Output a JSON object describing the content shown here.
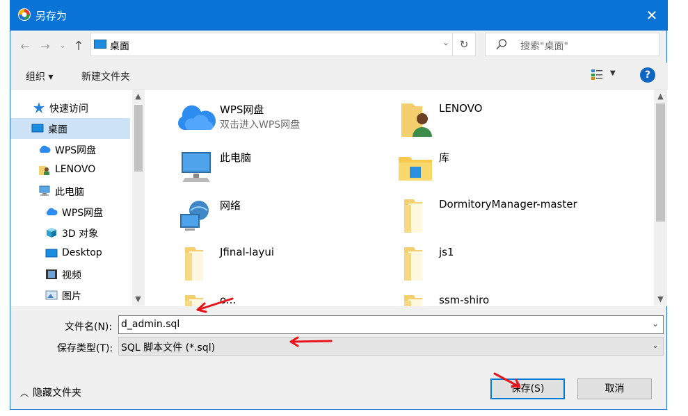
{
  "window": {
    "title": "另存为",
    "close_glyph": "✕"
  },
  "nav": {
    "back": "←",
    "forward": "→",
    "recent": "⌄",
    "up": "↑"
  },
  "address": {
    "location": "桌面",
    "dropdown": "⌄",
    "refresh": "↻"
  },
  "search": {
    "placeholder": "搜索\"桌面\""
  },
  "toolbar": {
    "organize": "组织 ▾",
    "new_folder": "新建文件夹",
    "help": "?"
  },
  "sidebar": {
    "items": [
      {
        "label": "快速访问",
        "icon": "star-icon"
      },
      {
        "label": "桌面",
        "icon": "desktop-icon",
        "selected": true
      },
      {
        "label": "WPS网盘",
        "icon": "cloud-icon"
      },
      {
        "label": "LENOVO",
        "icon": "user-folder-icon"
      },
      {
        "label": "此电脑",
        "icon": "computer-icon"
      },
      {
        "label": "WPS网盘",
        "icon": "cloud-icon"
      },
      {
        "label": "3D 对象",
        "icon": "cube-icon"
      },
      {
        "label": "Desktop",
        "icon": "desktop-icon"
      },
      {
        "label": "视频",
        "icon": "film-icon"
      },
      {
        "label": "图片",
        "icon": "picture-icon"
      }
    ]
  },
  "files": [
    {
      "name": "WPS网盘",
      "sub": "双击进入WPS网盘",
      "icon": "cloud-icon"
    },
    {
      "name": "LENOVO",
      "sub": "",
      "icon": "user-folder-icon"
    },
    {
      "name": "此电脑",
      "sub": "",
      "icon": "computer-icon"
    },
    {
      "name": "库",
      "sub": "",
      "icon": "library-icon"
    },
    {
      "name": "网络",
      "sub": "",
      "icon": "network-icon"
    },
    {
      "name": "DormitoryManager-master",
      "sub": "",
      "icon": "folder-icon"
    },
    {
      "name": "Jfinal-layui",
      "sub": "",
      "icon": "folder-icon"
    },
    {
      "name": "js1",
      "sub": "",
      "icon": "folder-icon"
    },
    {
      "name": "o...",
      "sub": "",
      "icon": "folder-icon"
    },
    {
      "name": "ssm-shiro",
      "sub": "",
      "icon": "folder-icon"
    }
  ],
  "form": {
    "filename_label": "文件名(N):",
    "filename_value": "d_admin.sql",
    "filetype_label": "保存类型(T):",
    "filetype_value": "SQL 脚本文件 (*.sql)"
  },
  "footer": {
    "hide_folders": "隐藏文件夹",
    "save": "保存(S)",
    "cancel": "取消"
  },
  "colors": {
    "titlebar": "#0a74d6",
    "selection": "#cde2f5",
    "annotation_red": "#e8141b"
  }
}
